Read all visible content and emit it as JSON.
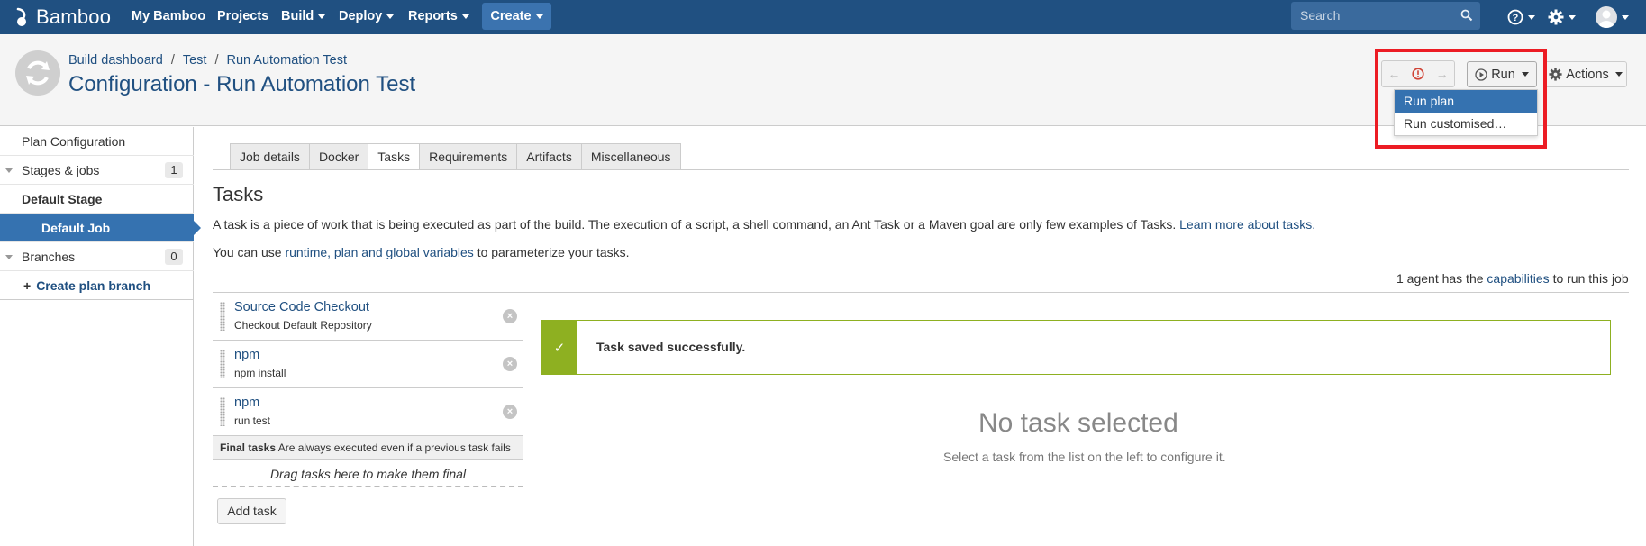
{
  "topbar": {
    "logo_text": "Bamboo",
    "nav": [
      {
        "label": "My Bamboo",
        "dropdown": false
      },
      {
        "label": "Projects",
        "dropdown": false
      },
      {
        "label": "Build",
        "dropdown": true
      },
      {
        "label": "Deploy",
        "dropdown": true
      },
      {
        "label": "Reports",
        "dropdown": true
      }
    ],
    "create_label": "Create",
    "search_placeholder": "Search",
    "icons": [
      "help-icon",
      "gear-icon",
      "avatar"
    ]
  },
  "header": {
    "breadcrumb": [
      "Build dashboard",
      "Test",
      "Run Automation Test"
    ],
    "title": "Configuration - Run Automation Test",
    "run_label": "Run",
    "actions_label": "Actions",
    "run_menu": [
      "Run plan",
      "Run customised…"
    ],
    "run_menu_active": "Run plan"
  },
  "sidebar": {
    "plan_configuration": "Plan Configuration",
    "stages_jobs": "Stages & jobs",
    "stages_jobs_count": "1",
    "default_stage": "Default Stage",
    "default_job": "Default Job",
    "branches": "Branches",
    "branches_count": "0",
    "create_branch": "Create plan branch"
  },
  "tabs": [
    "Job details",
    "Docker",
    "Tasks",
    "Requirements",
    "Artifacts",
    "Miscellaneous"
  ],
  "active_tab": "Tasks",
  "main": {
    "heading": "Tasks",
    "para1_prefix": "A task is a piece of work that is being executed as part of the build. The execution of a script, a shell command, an Ant Task or a Maven goal are only few examples of Tasks. ",
    "para1_link": "Learn more about tasks.",
    "para2_prefix": "You can use ",
    "para2_link": "runtime, plan and global variables",
    "para2_suffix": " to parameterize your tasks.",
    "agents_prefix": "1 agent has the ",
    "agents_link": "capabilities",
    "agents_suffix": " to run this job"
  },
  "tasks": [
    {
      "title": "Source Code Checkout",
      "subtitle": "Checkout Default Repository"
    },
    {
      "title": "npm",
      "subtitle": "npm install"
    },
    {
      "title": "npm",
      "subtitle": "run test"
    }
  ],
  "final_tasks": {
    "label": "Final tasks",
    "note": "Are always executed even if a previous task fails",
    "drop_zone": "Drag tasks here to make them final"
  },
  "add_task_label": "Add task",
  "success_message": "Task saved successfully.",
  "empty_state": {
    "title": "No task selected",
    "subtitle": "Select a task from the list on the left to configure it."
  },
  "colors": {
    "topbar": "#205081",
    "accent": "#3572b0",
    "success": "#8eb021",
    "highlight": "#ec1c24",
    "error_icon": "#d04437"
  }
}
